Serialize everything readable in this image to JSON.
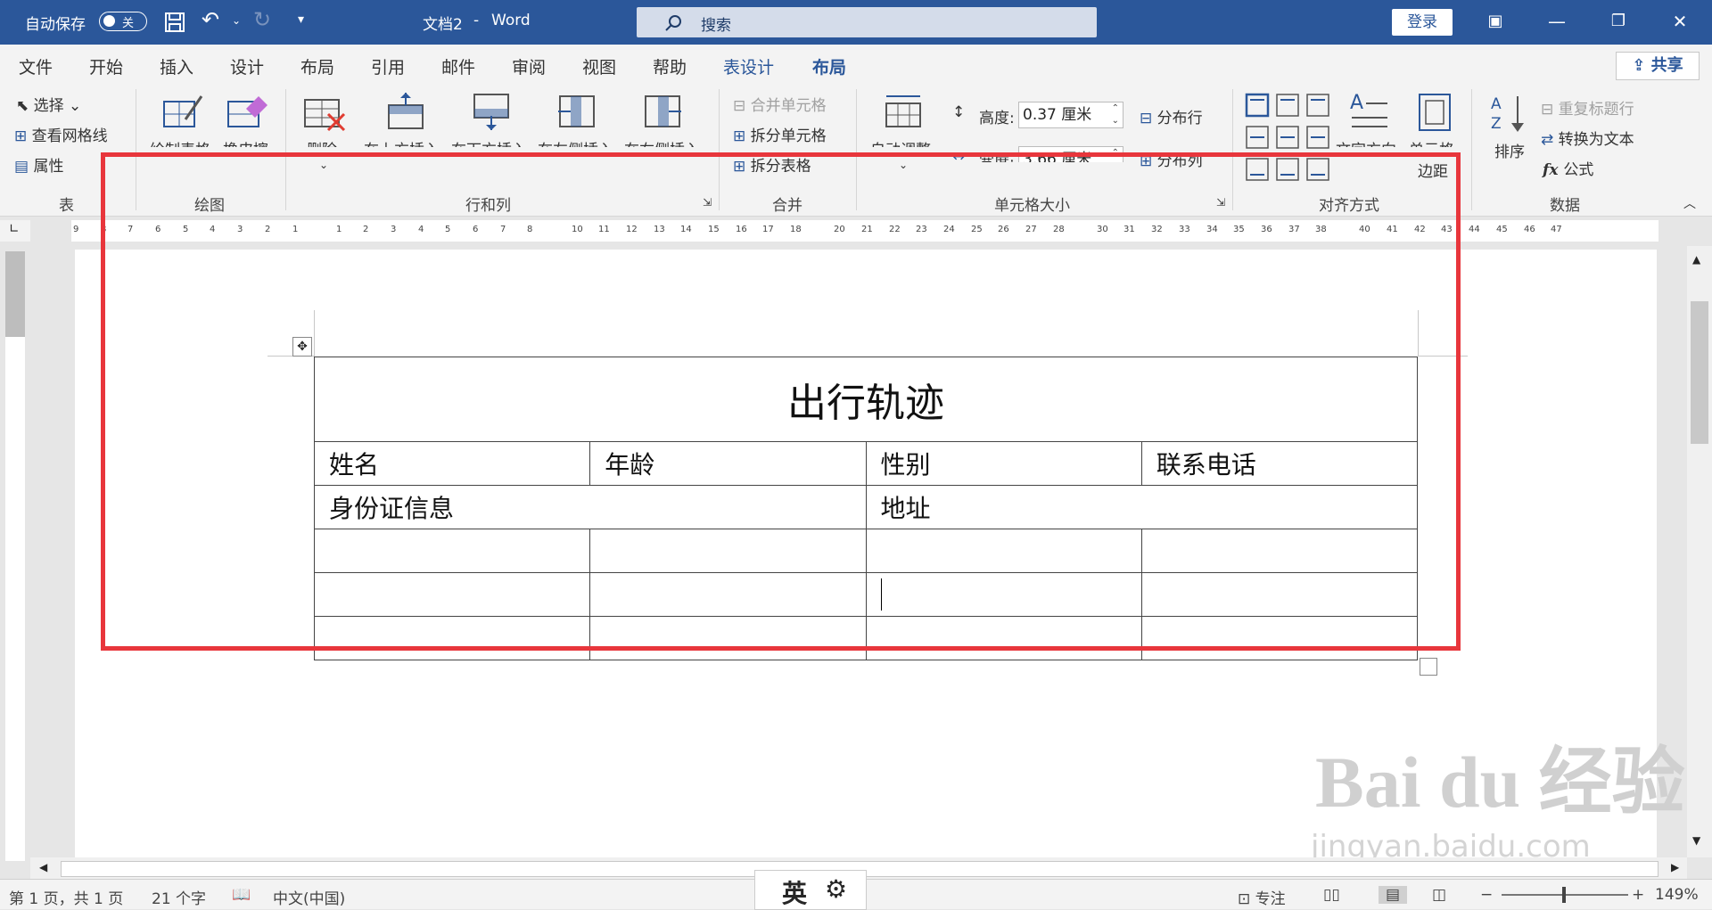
{
  "titlebar": {
    "autosave_label": "自动保存",
    "autosave_state": "关",
    "doc_title": "文档2",
    "app_sep": "-",
    "app_name": "Word",
    "search_placeholder": "搜索",
    "login": "登录",
    "bg_color": "#2b579a"
  },
  "tabs": [
    {
      "label": "文件"
    },
    {
      "label": "开始"
    },
    {
      "label": "插入"
    },
    {
      "label": "设计"
    },
    {
      "label": "布局"
    },
    {
      "label": "引用"
    },
    {
      "label": "邮件"
    },
    {
      "label": "审阅"
    },
    {
      "label": "视图"
    },
    {
      "label": "帮助"
    },
    {
      "label": "表设计"
    },
    {
      "label": "布局"
    }
  ],
  "share": "共享",
  "ribbon": {
    "table": {
      "select": "选择",
      "gridlines": "查看网格线",
      "properties": "属性",
      "group": "表"
    },
    "draw": {
      "draw_table": "绘制表格",
      "eraser": "橡皮擦",
      "group": "绘图"
    },
    "rows_cols": {
      "delete": "删除",
      "insert_above": "在上方插入",
      "insert_below": "在下方插入",
      "insert_left": "在左侧插入",
      "insert_right": "在右侧插入",
      "group": "行和列"
    },
    "merge": {
      "merge_cells": "合并单元格",
      "split_cells": "拆分单元格",
      "split_table": "拆分表格",
      "group": "合并"
    },
    "cell_size": {
      "autofit": "自动调整",
      "height_label": "高度:",
      "height_value": "0.37 厘米",
      "width_label": "宽度:",
      "width_value": "3.66 厘米",
      "dist_rows": "分布行",
      "dist_cols": "分布列",
      "group": "单元格大小"
    },
    "alignment": {
      "text_direction": "文字方向",
      "cell_margins_1": "单元格",
      "cell_margins_2": "边距",
      "group": "对齐方式"
    },
    "data": {
      "sort": "排序",
      "repeat_header": "重复标题行",
      "convert_text": "转换为文本",
      "formula": "公式",
      "group": "数据"
    }
  },
  "ruler_numbers": [
    "9",
    "8",
    "7",
    "6",
    "5",
    "4",
    "3",
    "2",
    "1",
    "1",
    "2",
    "3",
    "4",
    "5",
    "6",
    "7",
    "8",
    "10",
    "11",
    "12",
    "13",
    "14",
    "15",
    "16",
    "17",
    "18",
    "20",
    "21",
    "22",
    "23",
    "24",
    "25",
    "26",
    "27",
    "28",
    "30",
    "31",
    "32",
    "33",
    "34",
    "35",
    "36",
    "37",
    "38",
    "40",
    "41",
    "42",
    "43",
    "44",
    "45",
    "46",
    "47"
  ],
  "document": {
    "title": "出行轨迹",
    "row1": [
      "姓名",
      "年龄",
      "性别",
      "联系电话"
    ],
    "row2": [
      "身份证信息",
      "地址"
    ]
  },
  "status": {
    "page": "第 1 页，共 1 页",
    "words": "21 个字",
    "language": "中文(中国)",
    "ime": "英",
    "focus": "专注",
    "zoom": "149%"
  },
  "watermark": {
    "brand": "Bai du 经验",
    "url": "jingyan.baidu.com"
  },
  "colors": {
    "accent": "#2b579a",
    "highlight": "#e8363c"
  }
}
